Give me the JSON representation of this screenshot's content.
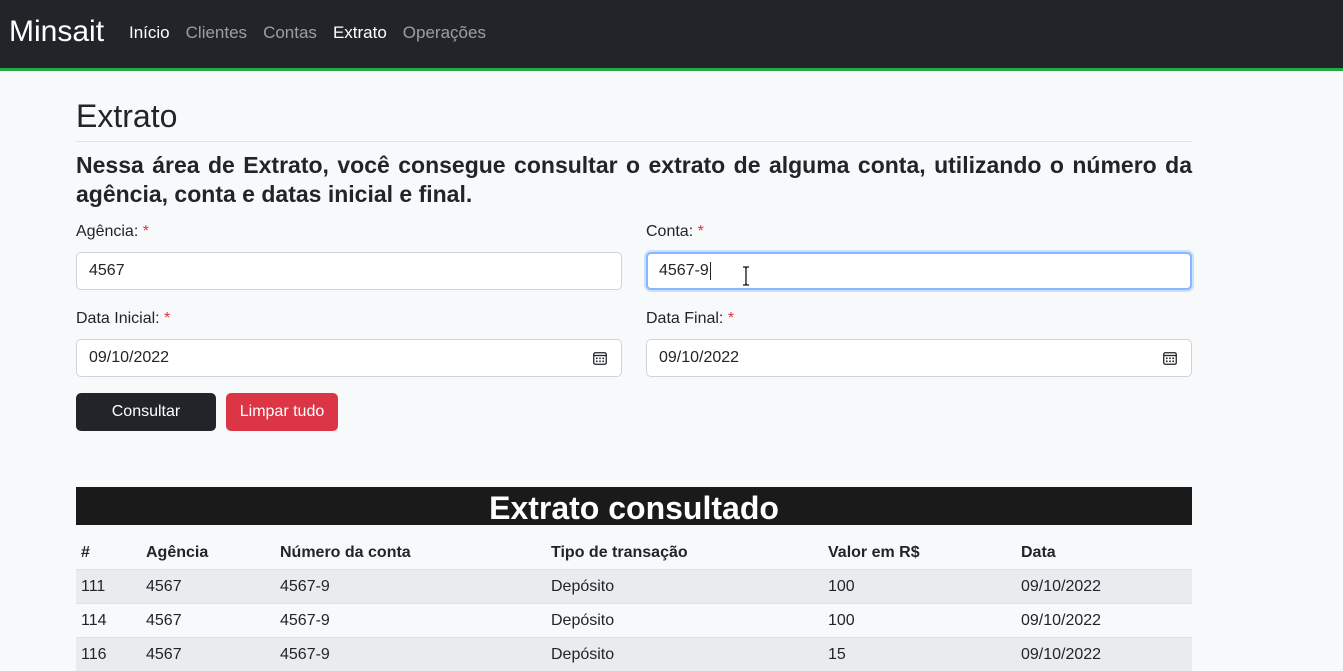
{
  "navbar": {
    "brand": "Minsait",
    "links": [
      {
        "label": "Início",
        "active": true
      },
      {
        "label": "Clientes",
        "active": false
      },
      {
        "label": "Contas",
        "active": false
      },
      {
        "label": "Extrato",
        "active": true
      },
      {
        "label": "Operações",
        "active": false
      }
    ],
    "accent_color": "#28a745"
  },
  "page": {
    "title": "Extrato",
    "description": "Nessa área de Extrato, você consegue consultar o extrato de alguma conta, utilizando o número da agência, conta e datas inicial e final."
  },
  "form": {
    "required_marker": "*",
    "agencia": {
      "label": "Agência:",
      "value": "4567"
    },
    "conta": {
      "label": "Conta:",
      "value": "4567-9"
    },
    "data_inicial": {
      "label": "Data Inicial:",
      "value": "09/10/2022"
    },
    "data_final": {
      "label": "Data Final:",
      "value": "09/10/2022"
    },
    "consultar_label": "Consultar",
    "limpar_label": "Limpar tudo"
  },
  "results": {
    "title": "Extrato consultado",
    "columns": [
      "#",
      "Agência",
      "Número da conta",
      "Tipo de transação",
      "Valor em R$",
      "Data"
    ],
    "rows": [
      [
        "111",
        "4567",
        "4567-9",
        "Depósito",
        "100",
        "09/10/2022"
      ],
      [
        "114",
        "4567",
        "4567-9",
        "Depósito",
        "100",
        "09/10/2022"
      ],
      [
        "116",
        "4567",
        "4567-9",
        "Depósito",
        "15",
        "09/10/2022"
      ]
    ]
  }
}
